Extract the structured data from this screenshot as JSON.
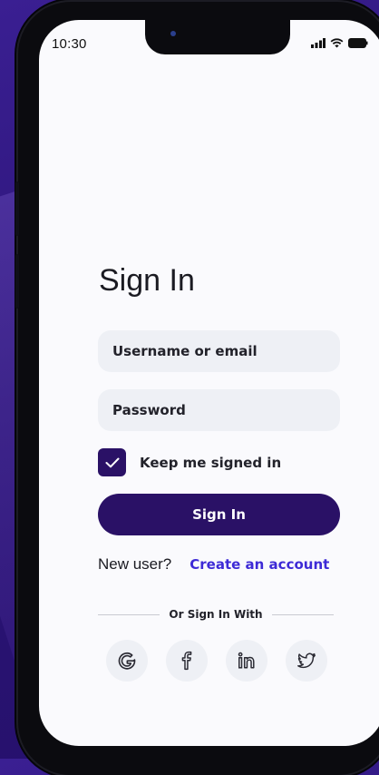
{
  "status_bar": {
    "time": "10:30"
  },
  "sign_in": {
    "title": "Sign In",
    "username_placeholder": "Username or email",
    "password_placeholder": "Password",
    "keep_signed_in_label": "Keep me signed in",
    "keep_signed_in_checked": true,
    "submit_label": "Sign In",
    "new_user_text": "New user?",
    "create_account_label": "Create an account",
    "divider_text": "Or Sign In With",
    "social_icons": [
      "google-icon",
      "facebook-icon",
      "linkedin-icon",
      "twitter-icon"
    ]
  },
  "colors": {
    "primary": "#2a1166",
    "link": "#3d2ad6",
    "field_bg": "#eef0f5",
    "background": "#2b1477"
  }
}
